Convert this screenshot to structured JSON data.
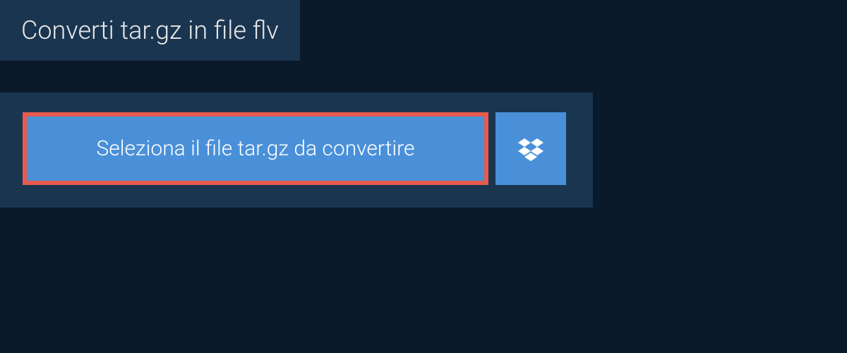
{
  "header": {
    "title": "Converti tar.gz in file flv"
  },
  "actions": {
    "select_file_label": "Seleziona il file tar.gz da convertire"
  },
  "colors": {
    "bg_dark": "#0a1a2a",
    "panel": "#1a3550",
    "button": "#4a90d9",
    "highlight_border": "#e85a4f",
    "text_light": "#e8e8e8"
  }
}
